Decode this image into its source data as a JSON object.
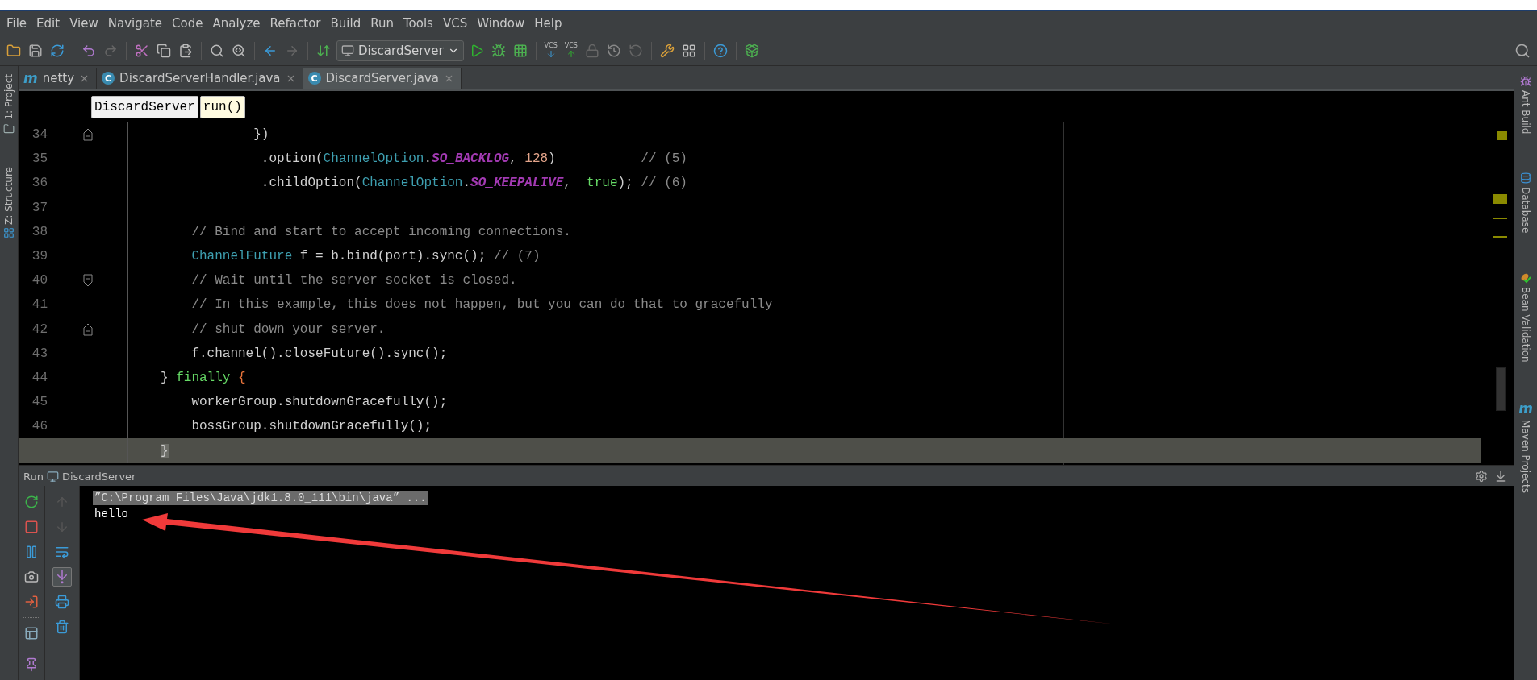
{
  "menu": [
    "File",
    "Edit",
    "View",
    "Navigate",
    "Code",
    "Analyze",
    "Refactor",
    "Build",
    "Run",
    "Tools",
    "VCS",
    "Window",
    "Help"
  ],
  "toolbar": {
    "run_config": "DiscardServer",
    "vcs_labels": [
      "VCS",
      "VCS"
    ]
  },
  "tabs": [
    {
      "badge": "m",
      "kind": "module",
      "label": "netty",
      "selected": false
    },
    {
      "badge": "C",
      "kind": "class",
      "label": "DiscardServerHandler.java",
      "selected": false
    },
    {
      "badge": "C",
      "kind": "class",
      "label": "DiscardServer.java",
      "selected": true
    }
  ],
  "left_tools": [
    "1: Project",
    "Z: Structure"
  ],
  "right_tools": [
    {
      "kind": "ant",
      "label": "Ant Build"
    },
    {
      "kind": "database",
      "label": "Database"
    },
    {
      "kind": "bean",
      "label": "Bean Validation"
    },
    {
      "kind": "maven",
      "badge": "m",
      "label": "Maven Projects"
    }
  ],
  "breadcrumbs": [
    {
      "label": "DiscardServer",
      "selected": false
    },
    {
      "label": "run()",
      "selected": true
    }
  ],
  "code": [
    {
      "number": "34",
      "fold_end": true,
      "current": false,
      "tokens": [
        {
          "kind": "plain",
          "text": "            })"
        }
      ]
    },
    {
      "number": "35",
      "current": false,
      "tokens": [
        {
          "kind": "plain",
          "text": "             .option("
        },
        {
          "kind": "class",
          "text": "ChannelOption"
        },
        {
          "kind": "plain",
          "text": "."
        },
        {
          "kind": "constant",
          "text": "SO_BACKLOG"
        },
        {
          "kind": "plain",
          "text": ", "
        },
        {
          "kind": "number",
          "text": "128"
        },
        {
          "kind": "plain",
          "text": ")           "
        },
        {
          "kind": "comment",
          "text": "// (5)"
        }
      ]
    },
    {
      "number": "36",
      "current": false,
      "tokens": [
        {
          "kind": "plain",
          "text": "             .childOption("
        },
        {
          "kind": "class",
          "text": "ChannelOption"
        },
        {
          "kind": "plain",
          "text": "."
        },
        {
          "kind": "constant",
          "text": "SO_KEEPALIVE"
        },
        {
          "kind": "plain",
          "text": ",  "
        },
        {
          "kind": "keyword",
          "text": "true"
        },
        {
          "kind": "plain",
          "text": "); "
        },
        {
          "kind": "comment",
          "text": "// (6)"
        }
      ]
    },
    {
      "number": "37",
      "current": false
    },
    {
      "number": "38",
      "current": false,
      "tokens": [
        {
          "kind": "comment",
          "text": "    // Bind and start to accept incoming connections."
        }
      ]
    },
    {
      "number": "39",
      "current": false,
      "tokens": [
        {
          "kind": "class",
          "text": "    ChannelFuture"
        },
        {
          "kind": "plain",
          "text": " f = b.bind(port).sync(); "
        },
        {
          "kind": "comment",
          "text": "// (7)"
        }
      ]
    },
    {
      "number": "40",
      "fold_start": true,
      "current": false,
      "tokens": [
        {
          "kind": "comment",
          "text": "    // Wait until the server socket is closed."
        }
      ]
    },
    {
      "number": "41",
      "current": false,
      "tokens": [
        {
          "kind": "comment",
          "text": "    // In this example, this does not happen, but you can do that to gracefully"
        }
      ]
    },
    {
      "number": "42",
      "fold_end": true,
      "current": false,
      "tokens": [
        {
          "kind": "comment",
          "text": "    // shut down your server."
        }
      ]
    },
    {
      "number": "43",
      "current": false,
      "tokens": [
        {
          "kind": "plain",
          "text": "    f.channel().closeFuture().sync();"
        }
      ]
    },
    {
      "number": "44",
      "current": false,
      "tokens": [
        {
          "kind": "plain",
          "text": "} "
        },
        {
          "kind": "keyword",
          "text": "finally"
        },
        {
          "kind": "brace",
          "text": " {"
        }
      ]
    },
    {
      "number": "45",
      "current": false,
      "tokens": [
        {
          "kind": "plain",
          "text": "    workerGroup.shutdownGracefully();"
        }
      ]
    },
    {
      "number": "46",
      "current": false,
      "tokens": [
        {
          "kind": "plain",
          "text": "    bossGroup.shutdownGracefully();"
        }
      ]
    },
    {
      "current": true,
      "tokens": [
        {
          "kind": "matched",
          "text": "}"
        }
      ]
    }
  ],
  "run_panel": {
    "title": "Run",
    "config": "DiscardServer",
    "stack_navigation_disabled": true,
    "scroll_to_end_selected": true,
    "output": [
      {
        "kind": "command",
        "text": "”C:\\Program Files\\Java\\jdk1.8.0_111\\bin\\java” ..."
      },
      {
        "kind": "stdout",
        "text": "hello"
      }
    ]
  }
}
